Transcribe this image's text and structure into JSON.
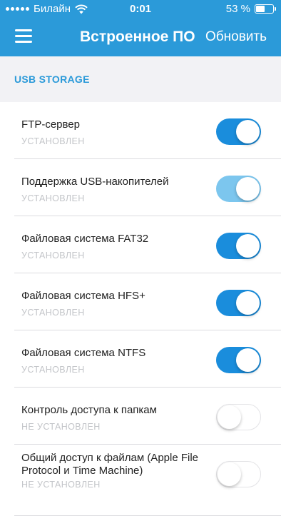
{
  "status_bar": {
    "carrier": "Билайн",
    "time": "0:01",
    "battery_percent": "53 %",
    "battery_level": 0.53
  },
  "header": {
    "title": "Встроенное ПО",
    "refresh_label": "Обновить",
    "background": "#2b9ad9"
  },
  "section": {
    "label": "USB STORAGE"
  },
  "components": [
    {
      "title": "FTP-сервер",
      "status": "УСТАНОВЛЕН",
      "enabled": true
    },
    {
      "title": "Поддержка USB-накопителей",
      "status": "УСТАНОВЛЕН",
      "enabled": true
    },
    {
      "title": "Файловая система FAT32",
      "status": "УСТАНОВЛЕН",
      "enabled": true
    },
    {
      "title": "Файловая система HFS+",
      "status": "УСТАНОВЛЕН",
      "enabled": true
    },
    {
      "title": "Файловая система NTFS",
      "status": "УСТАНОВЛЕН",
      "enabled": true
    },
    {
      "title": "Контроль доступа к папкам",
      "status": "НЕ УСТАНОВЛЕН",
      "enabled": false
    },
    {
      "title": "Общий доступ к файлам (Apple File Protocol и Time Machine)",
      "status": "НЕ УСТАНОВЛЕН",
      "enabled": false
    }
  ],
  "colors": {
    "accent": "#2b9ad9",
    "toggle_on": "#1a8ddc",
    "toggle_on_disabled": "#7cc6ee",
    "status_text": "#c3c5c9"
  }
}
